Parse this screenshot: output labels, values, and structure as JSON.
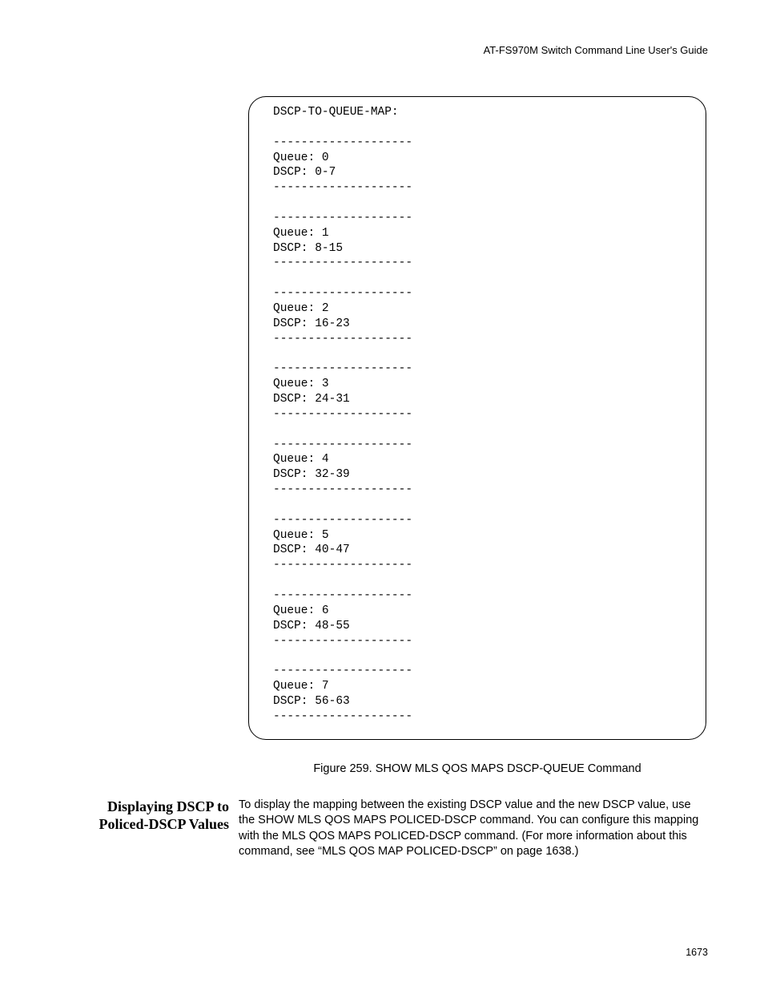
{
  "header": {
    "guideTitle": "AT-FS970M Switch Command Line User's Guide"
  },
  "terminal": {
    "title": "DSCP-TO-QUEUE-MAP:",
    "divider": "--------------------",
    "blocks": [
      {
        "queue": "Queue: 0",
        "dscp": "DSCP: 0-7"
      },
      {
        "queue": "Queue: 1",
        "dscp": "DSCP: 8-15"
      },
      {
        "queue": "Queue: 2",
        "dscp": "DSCP: 16-23"
      },
      {
        "queue": "Queue: 3",
        "dscp": "DSCP: 24-31"
      },
      {
        "queue": "Queue: 4",
        "dscp": "DSCP: 32-39"
      },
      {
        "queue": "Queue: 5",
        "dscp": "DSCP: 40-47"
      },
      {
        "queue": "Queue: 6",
        "dscp": "DSCP: 48-55"
      },
      {
        "queue": "Queue: 7",
        "dscp": "DSCP: 56-63"
      }
    ]
  },
  "figureCaption": "Figure 259. SHOW MLS QOS MAPS DSCP-QUEUE Command",
  "section": {
    "heading": "Displaying DSCP to Policed-DSCP Values",
    "body": "To display the mapping between the existing DSCP value and the new DSCP value, use the SHOW MLS QOS MAPS POLICED-DSCP command. You can configure this mapping with the MLS QOS MAPS POLICED-DSCP command. (For more information about this command, see “MLS QOS MAP POLICED-DSCP” on page 1638.)"
  },
  "pageNumber": "1673"
}
